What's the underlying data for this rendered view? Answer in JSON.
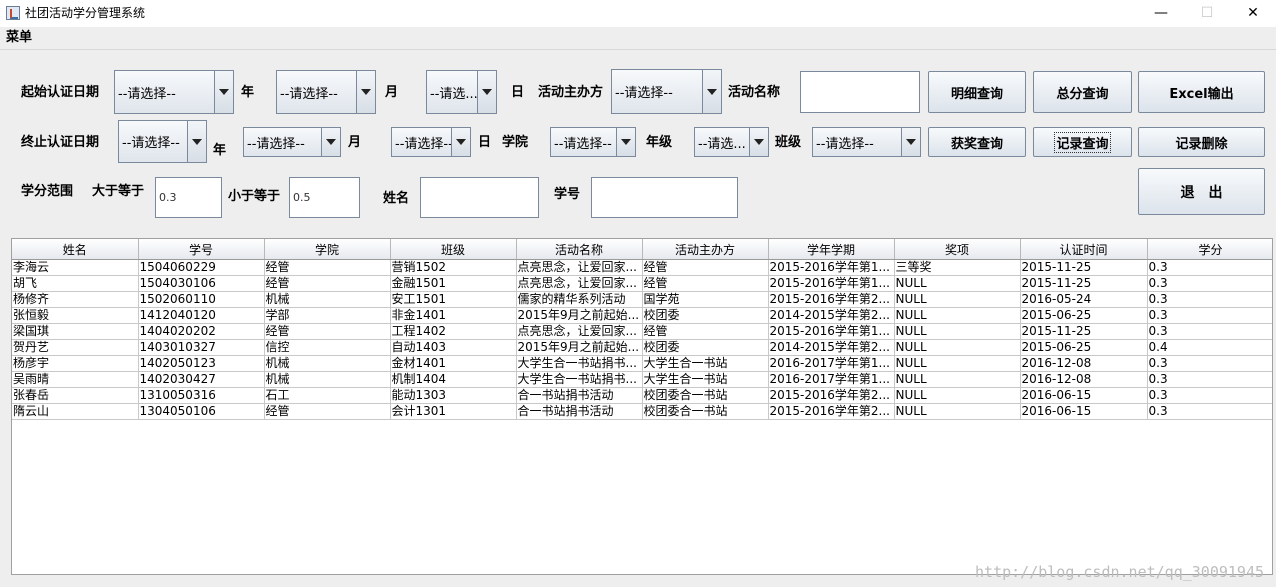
{
  "window": {
    "title": "社团活动学分管理系统",
    "controls": {
      "minimize": "—",
      "maximize": "☐",
      "close": "✕"
    }
  },
  "menu": {
    "items": [
      "菜单"
    ]
  },
  "form": {
    "start_date_label": "起始认证日期",
    "end_date_label": "终止认证日期",
    "placeholder_full": "--请选择--",
    "placeholder_short": "--请选...",
    "year_label": "年",
    "month_label": "月",
    "day_label": "日",
    "organizer_label": "活动主办方",
    "activity_name_label": "活动名称",
    "activity_name_value": "",
    "college_label": "学院",
    "grade_label": "年级",
    "class_label": "班级",
    "credit_range_label": "学分范围",
    "gte_label": "大于等于",
    "gte_value": "0.3",
    "lte_label": "小于等于",
    "lte_value": "0.5",
    "name_label": "姓名",
    "name_value": "",
    "student_id_label": "学号",
    "student_id_value": ""
  },
  "buttons": {
    "detail_query": "明细查询",
    "total_query": "总分查询",
    "excel_export": "Excel输出",
    "award_query": "获奖查询",
    "record_query": "记录查询",
    "record_delete": "记录删除",
    "exit": "退　出"
  },
  "table": {
    "columns": [
      "姓名",
      "学号",
      "学院",
      "班级",
      "活动名称",
      "活动主办方",
      "学年学期",
      "奖项",
      "认证时间",
      "学分"
    ],
    "rows": [
      [
        "李海云",
        "1504060229",
        "经管",
        "营销1502",
        "点亮思念，让爱回家...",
        "经管",
        "2015-2016学年第1...",
        "三等奖",
        "2015-11-25",
        "0.3"
      ],
      [
        "胡飞",
        "1504030106",
        "经管",
        "金融1501",
        "点亮思念，让爱回家...",
        "经管",
        "2015-2016学年第1...",
        "NULL",
        "2015-11-25",
        "0.3"
      ],
      [
        "杨修齐",
        "1502060110",
        "机械",
        "安工1501",
        "儒家的精华系列活动",
        "国学苑",
        "2015-2016学年第2...",
        "NULL",
        "2016-05-24",
        "0.3"
      ],
      [
        "张恒毅",
        "1412040120",
        "学部",
        "非金1401",
        "2015年9月之前起始...",
        "校团委",
        "2014-2015学年第2...",
        "NULL",
        "2015-06-25",
        "0.3"
      ],
      [
        "梁国琪",
        "1404020202",
        "经管",
        "工程1402",
        "点亮思念，让爱回家...",
        "经管",
        "2015-2016学年第1...",
        "NULL",
        "2015-11-25",
        "0.3"
      ],
      [
        "贺丹艺",
        "1403010327",
        "信控",
        "自动1403",
        "2015年9月之前起始...",
        "校团委",
        "2014-2015学年第2...",
        "NULL",
        "2015-06-25",
        "0.4"
      ],
      [
        "杨彦宇",
        "1402050123",
        "机械",
        "金材1401",
        "大学生合一书站捐书...",
        "大学生合一书站",
        "2016-2017学年第1...",
        "NULL",
        "2016-12-08",
        "0.3"
      ],
      [
        "吴雨晴",
        "1402030427",
        "机械",
        "机制1404",
        "大学生合一书站捐书...",
        "大学生合一书站",
        "2016-2017学年第1...",
        "NULL",
        "2016-12-08",
        "0.3"
      ],
      [
        "张春岳",
        "1310050316",
        "石工",
        "能动1303",
        "合一书站捐书活动",
        "校团委合一书站",
        "2015-2016学年第2...",
        "NULL",
        "2016-06-15",
        "0.3"
      ],
      [
        "隋云山",
        "1304050106",
        "经管",
        "会计1301",
        "合一书站捐书活动",
        "校团委合一书站",
        "2015-2016学年第2...",
        "NULL",
        "2016-06-15",
        "0.3"
      ]
    ]
  },
  "watermark": "http://blog.csdn.net/qq_30091945"
}
